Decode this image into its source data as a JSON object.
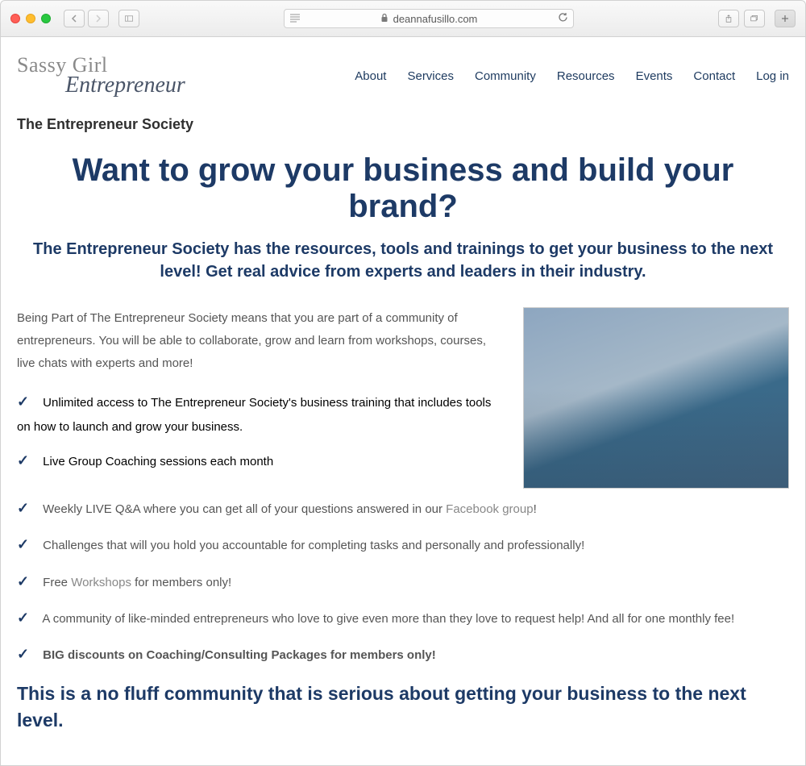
{
  "browser": {
    "url_host": "deannafusillo.com"
  },
  "site": {
    "logo_line1": "Sassy Girl",
    "logo_line2": "Entrepreneur",
    "nav": [
      "About",
      "Services",
      "Community",
      "Resources",
      "Events",
      "Contact",
      "Log in"
    ]
  },
  "page": {
    "title": "The Entrepreneur Society",
    "headline": "Want to grow your business and build your brand?",
    "subheadline": "The Entrepreneur Society has the resources, tools and trainings to get your business to the next level! Get real advice from experts and leaders in their industry.",
    "intro": "Being Part of The Entrepreneur Society means that you are part of a community of entrepreneurs. You will be able to collaborate, grow and learn from workshops, courses, live chats with experts and more!",
    "checks": {
      "c1": "Unlimited access to  The Entrepreneur Society's business training that includes tools on how to launch and grow your business.",
      "c2": "Live Group Coaching sessions each month",
      "c3_pre": "Weekly LIVE Q&A where you can get all of your questions answered in our  ",
      "c3_link": "Facebook group",
      "c3_post": "!",
      "c4": "Challenges that will you hold you accountable for completing tasks and personally and professionally!",
      "c5_pre": "Free ",
      "c5_link": "Workshops",
      "c5_post": " for members only!",
      "c6": "A community of like-minded entrepreneurs who love to give even more than they love to request help! And all for one monthly fee!",
      "c7": "BIG discounts on Coaching/Consulting Packages for members only!"
    },
    "closing": "This is a no fluff community that is serious about getting your business to the next level."
  }
}
